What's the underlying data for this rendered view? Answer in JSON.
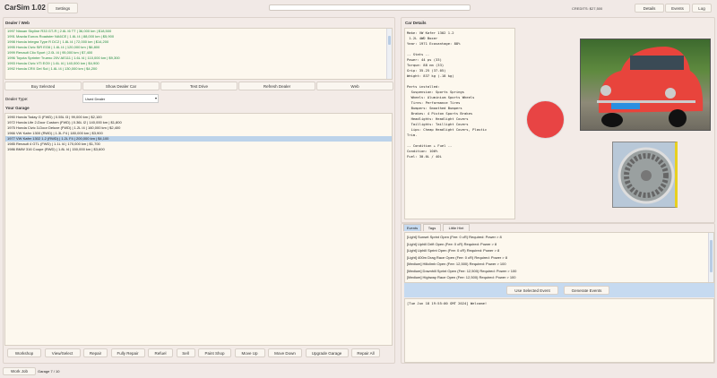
{
  "header": {
    "title": "CarSim 1.02",
    "settings": "Settings",
    "search_placeholder": "",
    "credits": "CREDITS: $27,500",
    "details": "Details",
    "events": "Events",
    "log": "Log"
  },
  "dealer": {
    "label": "Dealer / Web",
    "items": [
      "1997 Nissan Skyline R33 GT-R | 2.6L I6 TT | 36,000 km | $18,500",
      "1991 Mazda Eunos Roadster NA6CE | 1.6L I4 | 88,000 km | $5,900",
      "1998 Honda Integra Type R DC2 | 1.8L I4 | 72,000 km | $14,200",
      "1995 Honda Civic SiR EG6 | 1.6L I4 | 120,000 km | $6,800",
      "1999 Renault Clio Sport | 2.0L I4 | 95,000 km | $7,400",
      "1996 Toyota Sprinter Trueno 20V AE111 | 1.6L I4 | 110,000 km | $9,300",
      "1993 Honda Civic VTi EG9 | 1.6L I4 | 140,000 km | $4,900",
      "1992 Honda CRX Del Sol | 1.6L I4 | 130,000 km | $4,200"
    ],
    "buttons": [
      "Buy Selected",
      "Show Dealer Car",
      "Test Drive",
      "Refresh Dealer",
      "Web"
    ],
    "type_label": "Dealer Type:",
    "type_value": "Used Dealer"
  },
  "garage": {
    "label": "Your Garage",
    "items": [
      "1990 Honda Today G (FWD) | 0.55L I3 | 99,000 km | $2,100",
      "1972 Honda Life 2-Door Custom (FWD) | 0.36L I2 | 140,000 km | $1,800",
      "1975 Honda Civic 3-Door Deluxe (FWD) | 1.2L I4 | 160,000 km | $2,400",
      "1966 VW Kafer 1300 (RWD) | 1.3L F4 | 180,000 km | $3,900",
      "1977 VW Kafer 1302 1.2 (RWD) | 1.2L F4 | 200,000 km | $4,100",
      "1985 Renault 4 GTL (FWD) | 1.1L I4 | 170,000 km | $1,700",
      "1986 BMW 316 Coupe (RWD) | 1.8L I4 | 150,000 km | $3,600"
    ],
    "selected_index": 4,
    "buttons": [
      "Workshop",
      "View/Select",
      "Repair",
      "Fully Repair",
      "Refuel",
      "Sell",
      "Paint Shop",
      "Move Up",
      "Move Down",
      "Upgrade Garage",
      "Repair All"
    ]
  },
  "footer": {
    "work_job": "Work Job",
    "garage_count": "Garage 7 / 10"
  },
  "details": {
    "label": "Car Details",
    "text": "Make: VW Kafer 1302 1.2\n 1.2L 4WD Boxer\nYear: 1971 Ecovantage: 88%\n\n-- Stats --\nPower: 44 ps (33)\nTorque: 88 nm (33)\nGrip: 35.25 (37.05)\nWeight: 837 kg (-18 kg)\n\nParts installed:\n  Suspension: Sports Springs\n  Wheels: Aluminium Sports Wheels\n  Tires: Performance Tires\n  Bumpers: Smoothed Bumpers\n  Brakes: 4 Piston Sports Brakes\n  Headlights: Headlight Covers\n  Taillights: Taillight Covers\n  Lips: Cheap Headlight Covers, Plastic\nTrim.\n\n-- Condition + Fuel --\nCondition: 100%\nFuel: 30.0L / 40L",
    "color": "#e84444"
  },
  "events": {
    "tabs": [
      "Events",
      "Tags",
      "Little Hint"
    ],
    "items": [
      "[Light] Sunset Sprint Open (Fee: 0 cR) Required: Power > 8",
      "[Light] Uphill Drift Open (Fee: 0 cR) Required: Power > 8",
      "[Light] Uphill Sprint Open (Fee: 0 cR) Required: Power > 8",
      "[Light] 400m Drag Race Open (Fee: 0 cR) Required: Power > 8",
      "[Medium] Hillclimb Open (Fee: 12,500) Required: Power > 100",
      "[Medium] Downhill Sprint Open (Fee: 12,500) Required: Power > 100",
      "[Medium] Highway Race Open (Fee: 12,500) Required: Power > 100"
    ],
    "use_selected": "Use Selected Event",
    "generate": "Generate Events"
  },
  "log": {
    "text": "[Tue Jun 18 19:55:00 GMT 2024] Welcome!"
  }
}
